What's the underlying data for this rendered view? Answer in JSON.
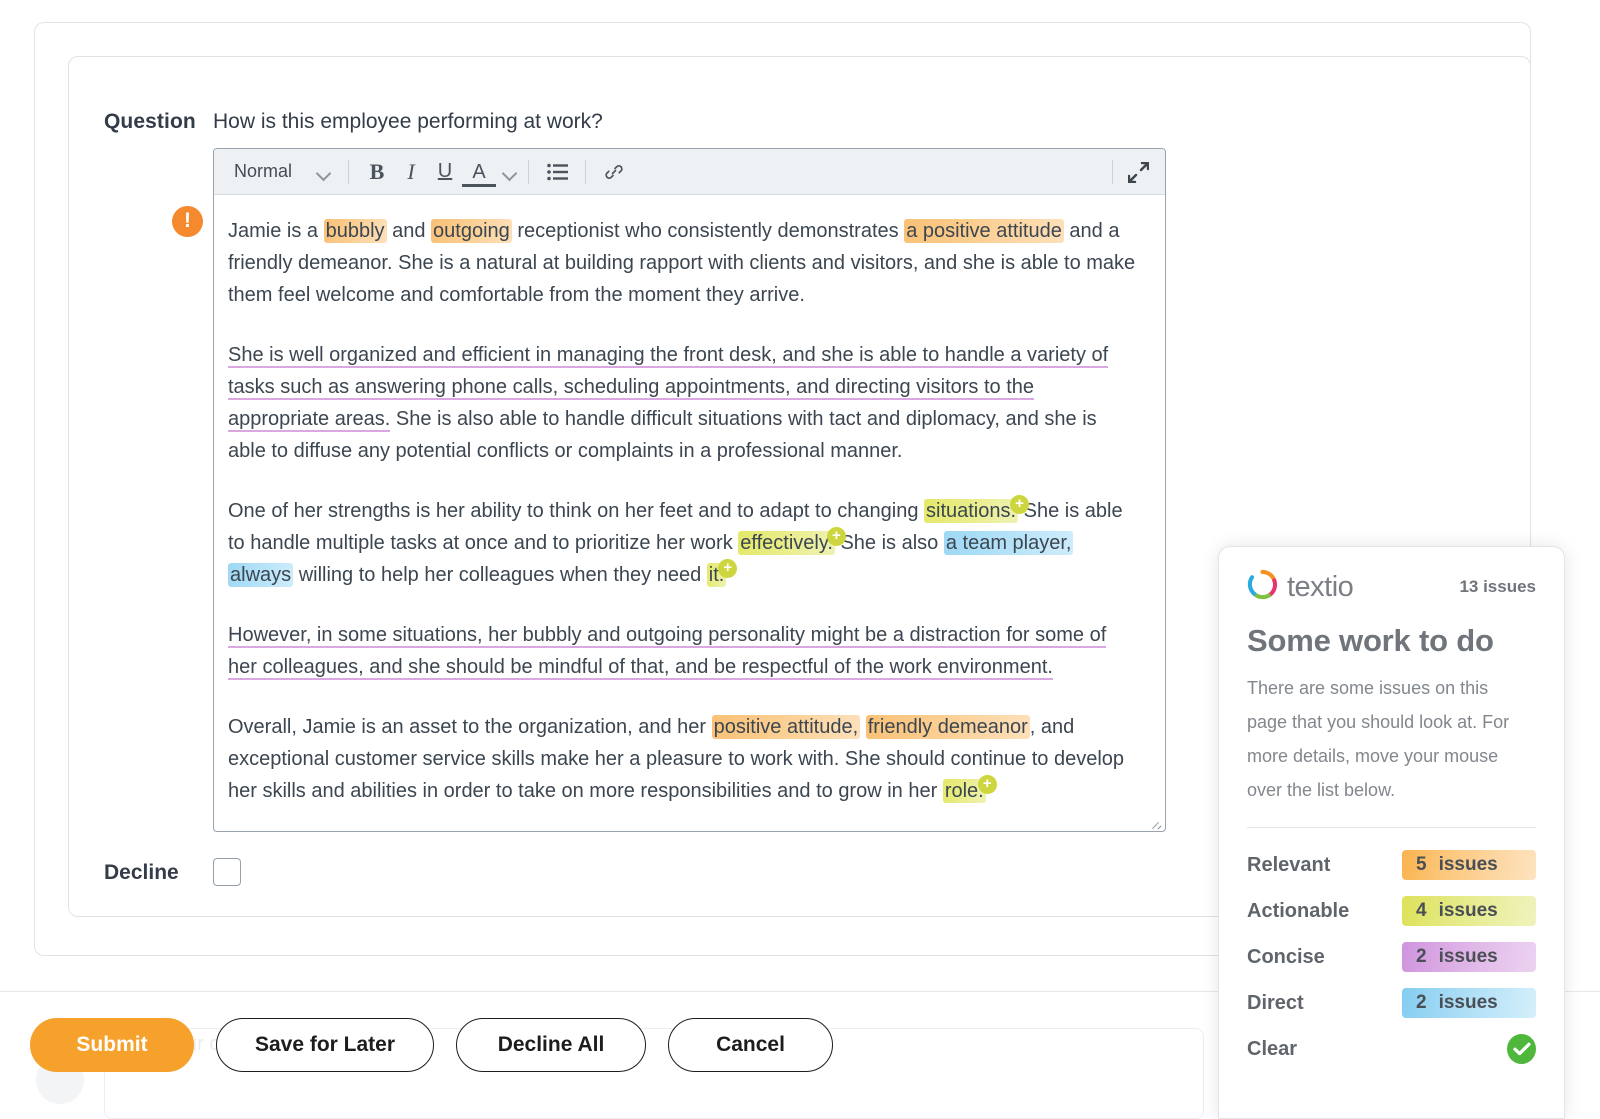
{
  "question": {
    "label": "Question",
    "text": "How is this employee performing at work?"
  },
  "editor": {
    "toolbar": {
      "style_value": "Normal",
      "style_dropdown_icon": "chevron-down-icon",
      "bold": "B",
      "italic": "I",
      "underline": "U",
      "text_color": "A",
      "color_dropdown_icon": "chevron-down-icon",
      "list_icon": "bullet-list-icon",
      "link_icon": "link-icon",
      "expand_icon": "expand-arrows-icon"
    },
    "warning_icon": "warning-exclamation-icon",
    "paragraphs": {
      "p1": {
        "s1": "Jamie is a ",
        "h1": "bubbly",
        "s2": " and ",
        "h2": "outgoing",
        "s3": " receptionist who consistently demonstrates ",
        "h3": "a positive attitude",
        "s4": " and a friendly demeanor. She is a natural at building rapport with clients and visitors, and she is able to make them feel welcome and comfortable from the moment they arrive."
      },
      "p2": {
        "u1": "She is well organized and efficient in managing the front desk, and she is able to handle a variety of tasks such as answering phone calls, scheduling appointments, and directing visitors to the appropriate areas.",
        "s1": " She is also able to handle difficult situations with tact and diplomacy, and she is able to diffuse any potential conflicts or complaints in a professional manner."
      },
      "p3": {
        "s1": "One of her strengths is her ability to think on her feet and to adapt to changing ",
        "h1": "situations.",
        "s2": " She is able to handle multiple tasks at once and to prioritize her work ",
        "h2": "effectively.",
        "s3": " She is also ",
        "h3": "a team player,",
        "s4": " ",
        "h4": "always",
        "s5": " willing to help her colleagues when they need ",
        "h5": "it."
      },
      "p4": {
        "u1": "However, in some situations, her bubbly and outgoing personality might be a distraction for some of her colleagues, and she should be mindful of that, and be respectful of the work environment."
      },
      "p5": {
        "s1": "Overall, Jamie is an asset to the organization, and her ",
        "h1": "positive attitude,",
        "s2": " ",
        "h2": "friendly demeanor",
        "s3": ", and exceptional customer service skills make her a pleasure to work with. She should continue to develop her skills and abilities in order to take on more responsibilities and to grow in her ",
        "h3": "role."
      }
    },
    "badge_plus": "+"
  },
  "decline": {
    "label": "Decline",
    "checked": false
  },
  "buttons": {
    "submit": "Submit",
    "save_for_later": "Save for Later",
    "decline_all": "Decline All",
    "cancel": "Cancel"
  },
  "ghost": {
    "text": "ur c"
  },
  "textio": {
    "logo_icon": "textio-ring-logo-icon",
    "wordmark": "textio",
    "issues_count": "13 issues",
    "title": "Some work to do",
    "description": "There are some issues on this page that you should look at. For more details, move your mouse over the list below.",
    "metrics": [
      {
        "name": "Relevant",
        "count": "5",
        "unit": "issues",
        "color": "#fab34f",
        "style": "pill-orange"
      },
      {
        "name": "Actionable",
        "count": "4",
        "unit": "issues",
        "color": "#dde25a",
        "style": "pill-yellow"
      },
      {
        "name": "Concise",
        "count": "2",
        "unit": "issues",
        "color": "#cf94dd",
        "style": "pill-purple"
      },
      {
        "name": "Direct",
        "count": "2",
        "unit": "issues",
        "color": "#84cdf0",
        "style": "pill-blue"
      }
    ],
    "clear": {
      "name": "Clear",
      "status_icon": "green-check-circle-icon"
    }
  },
  "colors": {
    "accent_orange": "#f5a12c",
    "warning_orange": "#f4892e",
    "highlight_orange": "#fac177",
    "highlight_yellow": "#e4e86a",
    "highlight_blue": "#9ed8f5",
    "underline_purple": "#d9a8e0",
    "success_green": "#4fb83c"
  }
}
